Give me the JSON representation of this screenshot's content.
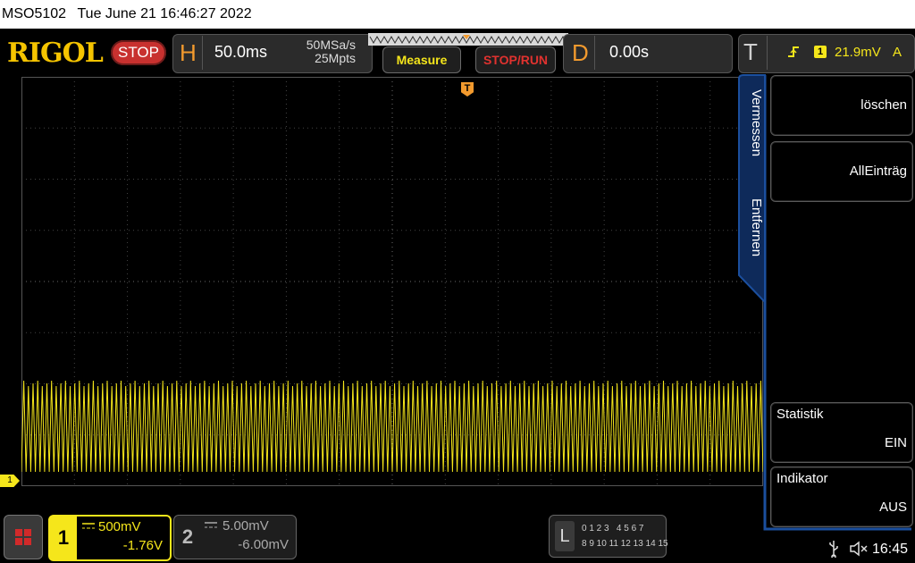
{
  "status_bar": {
    "model": "MSO5102",
    "datetime": "Tue June 21 16:46:27 2022"
  },
  "brand": {
    "logo": "RIGOL",
    "run_state": "STOP"
  },
  "horizontal": {
    "letter": "H",
    "timebase": "50.0ms",
    "sample_rate": "50MSa/s",
    "memory_depth": "25Mpts"
  },
  "toolbar": {
    "measure_label": "Measure",
    "stop_run_label": "STOP/RUN"
  },
  "delay": {
    "letter": "D",
    "value": "0.00s"
  },
  "trigger": {
    "letter": "T",
    "channel": "1",
    "level": "21.9mV",
    "mode": "A",
    "marker": "T"
  },
  "menu": {
    "title": "Vermessen",
    "title2": "Entfernen",
    "items": [
      {
        "label": "löschen",
        "value": ""
      },
      {
        "label": "AllEinträg",
        "value": ""
      },
      {
        "label": "Statistik",
        "value": "EIN"
      },
      {
        "label": "Indikator",
        "value": "AUS"
      }
    ]
  },
  "channel1": {
    "number": "1",
    "scale": "500mV",
    "offset": "-1.76V",
    "marker": "1",
    "color": "#f5e61b"
  },
  "channel2": {
    "number": "2",
    "scale": "5.00mV",
    "offset": "-6.00mV"
  },
  "logic": {
    "letter": "L",
    "row1": "0 1 2 3   4 5 6 7",
    "row2": "8 9 10 11 12 13 14 15"
  },
  "system": {
    "time": "16:45",
    "usb_icon": "usb-icon",
    "mute_icon": "speaker-mute-icon"
  },
  "waveform": {
    "cycles": 160,
    "high_level_div": 0.0,
    "low_level_div": -1.7
  }
}
